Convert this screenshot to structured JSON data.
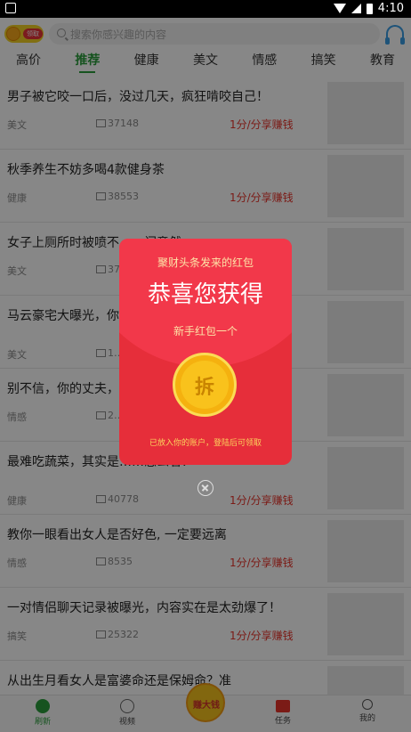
{
  "status_bar": {
    "time": "4:10"
  },
  "header": {
    "logo_tag": "领取",
    "search_placeholder": "搜索你感兴趣的内容"
  },
  "tabs": [
    "高价",
    "推荐",
    "健康",
    "美文",
    "情感",
    "搞笑",
    "教育"
  ],
  "active_tab": "推荐",
  "articles": [
    {
      "title": "男子被它咬一口后，没过几天，疯狂啃咬自己！",
      "category": "美文",
      "views": "37148",
      "earn": "1分/分享赚钱"
    },
    {
      "title": "秋季养生不妨多喝4款健身茶",
      "category": "健康",
      "views": "38553",
      "earn": "1分/分享赚钱"
    },
    {
      "title": "女子上厕所时被喷不……闪竟然",
      "category": "美文",
      "views": "37…",
      "earn": ""
    },
    {
      "title": "马云豪宅大曝光，你……第一，实至名归！",
      "category": "美文",
      "views": "1…",
      "earn": ""
    },
    {
      "title": "别不信，你的丈夫，……）",
      "category": "情感",
      "views": "2…",
      "earn": ""
    },
    {
      "title": "最难吃蔬菜，其实是……怎么看？",
      "category": "健康",
      "views": "40778",
      "earn": "1分/分享赚钱"
    },
    {
      "title": "教你一眼看出女人是否好色, 一定要远离",
      "category": "情感",
      "views": "8535",
      "earn": "1分/分享赚钱"
    },
    {
      "title": "一对情侣聊天记录被曝光，内容实在是太劲爆了！",
      "category": "搞笑",
      "views": "25322",
      "earn": "1分/分享赚钱"
    },
    {
      "title": "从出生月看女人是富婆命还是保姆命？准",
      "category": "",
      "views": "",
      "earn": ""
    }
  ],
  "tabbar": {
    "refresh": "刷新",
    "video": "视频",
    "center": "赚大钱",
    "task": "任务",
    "me": "我的"
  },
  "red_packet": {
    "source": "聚财头条发来的红包",
    "headline": "恭喜您获得",
    "subtitle": "新手红包一个",
    "coin_label": "拆",
    "note": "已放入你的账户，登陆后可领取"
  },
  "colors": {
    "accent_green": "#2a9d3c",
    "earn_red": "#e8342b",
    "packet_red": "#e62e3a",
    "coin_gold": "#f9c21c"
  }
}
